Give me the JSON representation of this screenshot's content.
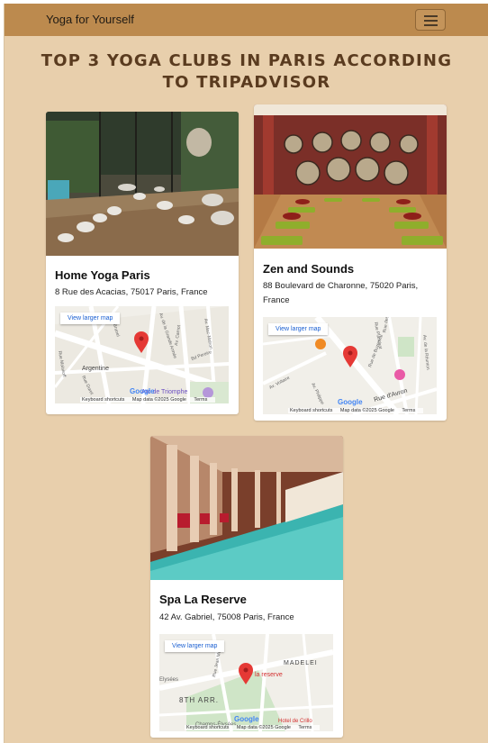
{
  "navbar": {
    "brand": "Yoga for Yourself",
    "menu_icon": "hamburger-menu-icon"
  },
  "page": {
    "heading": "Top 3 Yoga Clubs in Paris According to TripAdvisor"
  },
  "map_common": {
    "larger_map": "View larger map",
    "keyboard": "Keyboard shortcuts",
    "mapdata": "Map data ©2025 Google",
    "terms": "Terms",
    "google": "Google"
  },
  "clubs": [
    {
      "name": "Home Yoga Paris",
      "address": "8 Rue des Acacias, 75017 Paris, France",
      "map_labels": [
        "Argentine",
        "Arc de Triomphe",
        "Rue Brunel",
        "Av. de la Grande Armée",
        "Av. Carnot",
        "Av. Mac-Mahon",
        "Rue Duret",
        "Bd Pereire",
        "Rue Malakoff"
      ]
    },
    {
      "name": "Zen and Sounds",
      "address": "88 Boulevard de Charonne, 75020 Paris, France",
      "map_labels": [
        "Av. Voltaire",
        "Av. Philippe",
        "Rue d'Avron",
        "Av. de la Réunion",
        "Rue des Vignoles",
        "Rue Planchat",
        "Rue de Buzenval"
      ]
    },
    {
      "name": "Spa La Reserve",
      "address": "42 Av. Gabriel, 75008 Paris, France",
      "map_labels": [
        "la reserve",
        "MADELEI",
        "8TH ARR.",
        "Elysées",
        "Rue Jean Mermoz",
        "Champs-Élysées",
        "Hotel de Crillo"
      ]
    }
  ],
  "colors": {
    "page_bg": "#e8cfac",
    "navbar_bg": "#bc8a4e",
    "heading": "#5a3b1f",
    "map_pin": "#e53935"
  }
}
